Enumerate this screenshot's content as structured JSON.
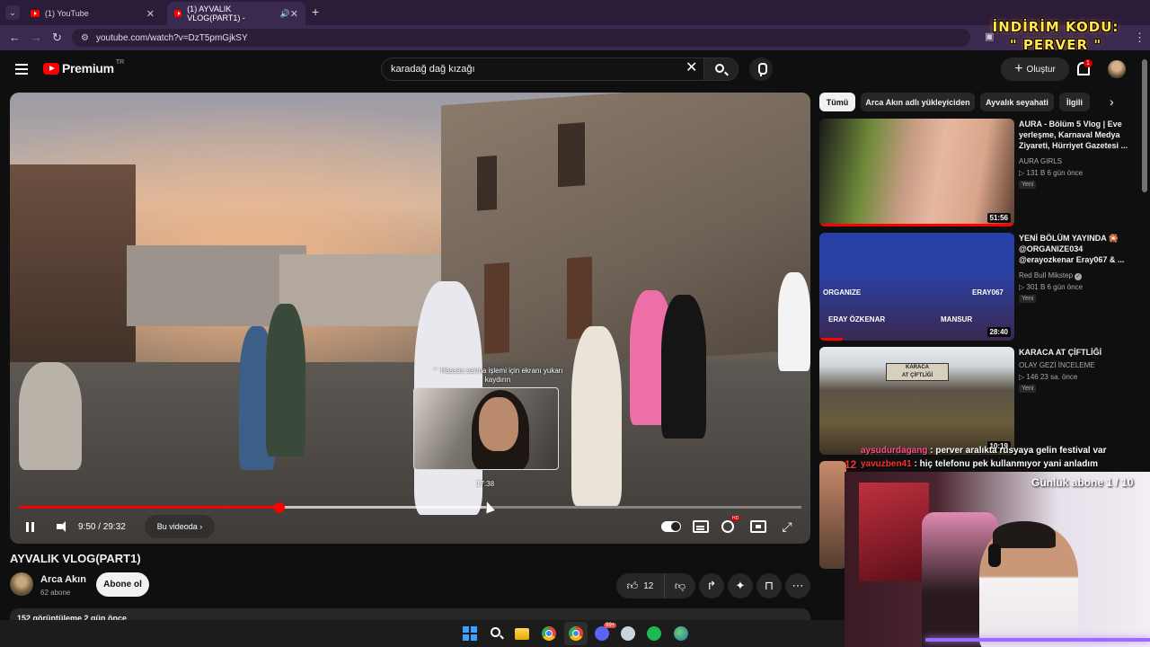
{
  "browser": {
    "tabs": [
      {
        "title": "(1) YouTube",
        "active": false
      },
      {
        "title": "(1) AYVALIK VLOG(PART1) -",
        "active": true
      }
    ],
    "new_tab": "+",
    "url": "youtube.com/watch?v=DzT5pmGjkSY"
  },
  "promo": {
    "line1": "İNDİRİM KODU:",
    "line2": "\" PERVER \""
  },
  "header": {
    "logo_text": "Premium",
    "logo_country": "TR",
    "search_value": "karadağ dağ kızağı",
    "create_label": "Oluştur",
    "notification_count": "1"
  },
  "player": {
    "pip_hint": "⌃ Hassas sarma işlemi için ekranı yukarı kaydırın",
    "hover_time": "17:38",
    "current_time": "9:50",
    "duration": "29:32",
    "time_display": "9:50 / 29:32",
    "chapter_label": "Bu videoda ›",
    "progress_fraction": 0.333
  },
  "video": {
    "title": "AYVALIK VLOG(PART1)",
    "channel": "Arca Akın",
    "subscribers": "62 abone",
    "subscribe_label": "Abone ol",
    "likes": "12",
    "description_meta": "152 görüntüleme  2 gün önce"
  },
  "chips": [
    "Tümü",
    "Arca Akın adlı yükleyiciden",
    "Ayvalık seyahati",
    "İlgili"
  ],
  "recommendations": [
    {
      "title": "AURA - Bölüm 5 Vlog | Eve yerleşme, Karnaval Medya Ziyareti, Hürriyet Gazetesi ...",
      "channel": "AURA GIRLS",
      "meta": "▷ 131 B   6 gün önce",
      "badge": "Yeni",
      "duration": "51:56",
      "verified": false
    },
    {
      "title": "YENİ BÖLÜM YAYINDA 🎇 @ORGANIZE034 @erayozkenar  Eray067 & ...",
      "channel": "Red Bull Mikstep",
      "meta": "▷ 301 B   6 gün önce",
      "badge": "Yeni",
      "duration": "28:40",
      "verified": true
    },
    {
      "title": "KARACA AT ÇİFTLİĞİ",
      "channel": "OLAY GEZİ İNCELEME",
      "meta": "▷ 146   23 sa. önce",
      "badge": "Yeni",
      "duration": "10:19",
      "verified": false
    }
  ],
  "stream": {
    "chat": [
      {
        "user": "aysudurdagang",
        "message": " : perver aralıkta rusyaya gelin festival var"
      },
      {
        "user": "yavuzben41",
        "message": " : hiç telefonu pek kullanmıyor yani anladım"
      }
    ],
    "sub_goal": "Günlük abone 1 / 10",
    "goal_count": "12"
  },
  "taskbar": {
    "discord_badge": "99+"
  }
}
